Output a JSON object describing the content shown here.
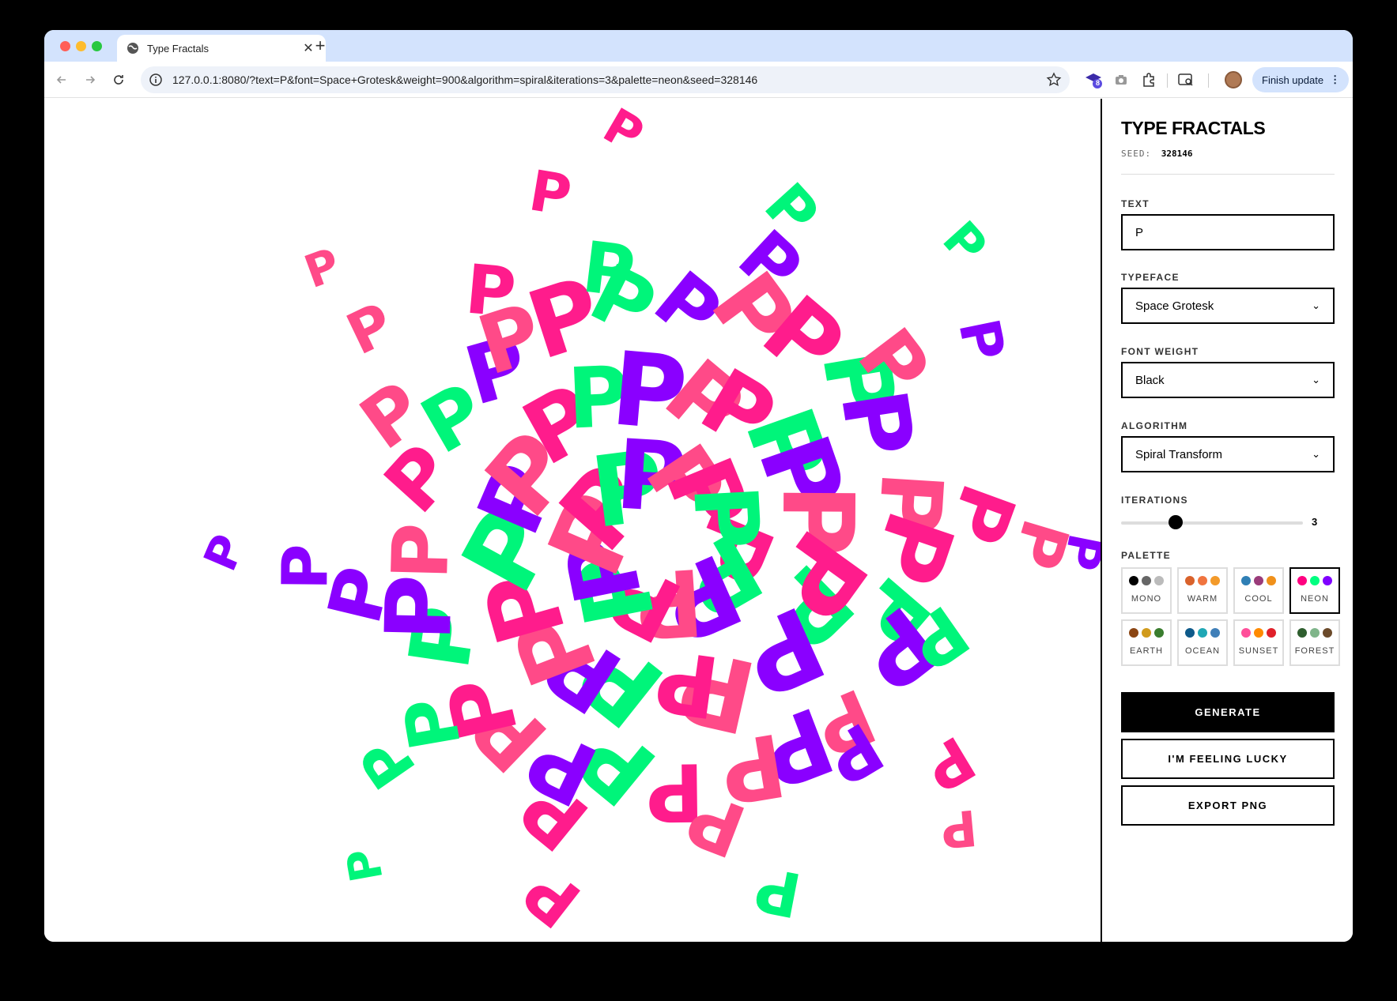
{
  "browser": {
    "tab_title": "Type Fractals",
    "url": "127.0.0.1:8080/?text=P&font=Space+Grotesk&weight=900&algorithm=spiral&iterations=3&palette=neon&seed=328146",
    "finish_update_label": "Finish update",
    "extension_badge": "8"
  },
  "panel": {
    "title": "TYPE FRACTALS",
    "seed_label": "SEED:",
    "seed_value": "328146",
    "text_label": "TEXT",
    "text_value": "P",
    "typeface_label": "TYPEFACE",
    "typeface_value": "Space Grotesk",
    "weight_label": "FONT WEIGHT",
    "weight_value": "Black",
    "algorithm_label": "ALGORITHM",
    "algorithm_value": "Spiral Transform",
    "iterations_label": "ITERATIONS",
    "iterations_value": "3",
    "iterations_fraction": 0.3,
    "palette_label": "PALETTE",
    "palettes": [
      {
        "name": "MONO",
        "colors": [
          "#000000",
          "#666666",
          "#bbbbbb"
        ],
        "active": false
      },
      {
        "name": "WARM",
        "colors": [
          "#d9622b",
          "#f0743f",
          "#f39a2a"
        ],
        "active": false
      },
      {
        "name": "COOL",
        "colors": [
          "#2f7fb5",
          "#9a3b7a",
          "#f0901a"
        ],
        "active": false
      },
      {
        "name": "NEON",
        "colors": [
          "#ff0080",
          "#00ff80",
          "#8000ff"
        ],
        "active": true
      },
      {
        "name": "EARTH",
        "colors": [
          "#8b4513",
          "#d19b1c",
          "#3a7d2e"
        ],
        "active": false
      },
      {
        "name": "OCEAN",
        "colors": [
          "#0e5a8a",
          "#1fa7b5",
          "#3f7fb8"
        ],
        "active": false
      },
      {
        "name": "SUNSET",
        "colors": [
          "#ff4f9a",
          "#ff8a00",
          "#e0202a"
        ],
        "active": false
      },
      {
        "name": "FOREST",
        "colors": [
          "#2e5e2e",
          "#7fb58a",
          "#6b4a2a"
        ],
        "active": false
      }
    ],
    "generate_label": "GENERATE",
    "lucky_label": "I'M FEELING LUCKY",
    "export_label": "EXPORT PNG"
  },
  "canvas": {
    "glyph": "P",
    "colors": [
      "#ff1c8c",
      "#00f57a",
      "#8a00ff",
      "#ff4a88"
    ]
  }
}
